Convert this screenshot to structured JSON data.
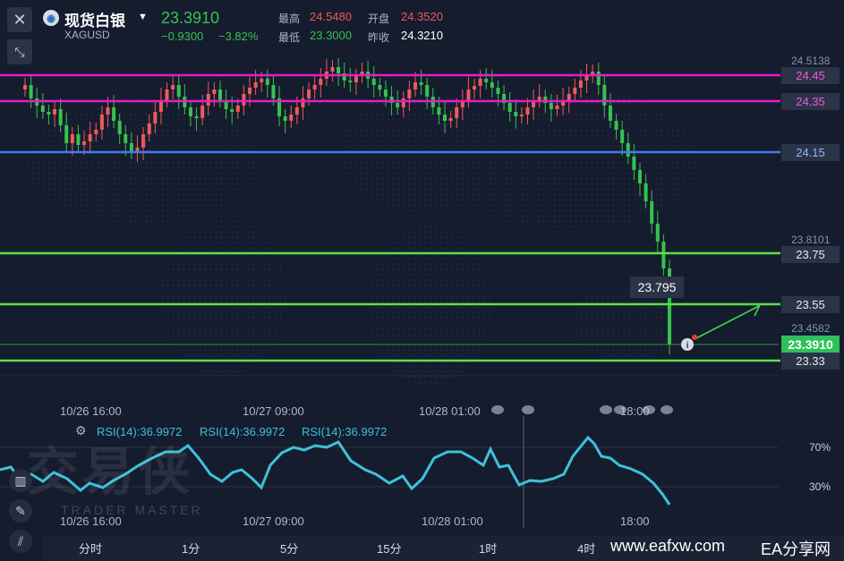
{
  "header": {
    "name": "现货白银",
    "symbol": "XAGUSD",
    "price": "23.3910",
    "change": "−0.9300",
    "change_pct": "−3.82%",
    "high_label": "最高",
    "high_value": "24.5480",
    "open_label": "开盘",
    "open_value": "24.3520",
    "low_label": "最低",
    "low_value": "23.3000",
    "prev_label": "昨收",
    "prev_value": "24.3210"
  },
  "axis": {
    "top": "24.5138",
    "mid": "23.8101",
    "low": "23.4582",
    "rsi_70": "70%",
    "rsi_30": "30%"
  },
  "levels": [
    {
      "label": "24.45",
      "color": "#e51ec8"
    },
    {
      "label": "24.35",
      "color": "#e51ec8"
    },
    {
      "label": "24.15",
      "color": "#3f7df0"
    },
    {
      "label": "23.75",
      "color": "#5be04a"
    },
    {
      "label": "23.55",
      "color": "#5be04a"
    },
    {
      "label": "23.33",
      "color": "#5be04a"
    }
  ],
  "current_price_label": "23.3910",
  "tooltip": "23.795",
  "time_labels": {
    "main": [
      "10/26 16:00",
      "10/27 09:00",
      "10/28 01:00",
      "18:00"
    ],
    "lower": [
      "10/26 16:00",
      "10/27 09:00",
      "10/28 01:00",
      "18:00"
    ]
  },
  "rsi_labels": [
    "RSI(14):36.9972",
    "RSI(14):36.9972",
    "RSI(14):36.9972"
  ],
  "timeframes": [
    "分时",
    "1分",
    "5分",
    "15分",
    "1时",
    "4时"
  ],
  "brand": {
    "site": "www.eafxw.com",
    "name": "EA分享网"
  },
  "watermark": {
    "cn": "交易侠",
    "en": "TRADER MASTER"
  },
  "colors": {
    "up": "#f05a5a",
    "down": "#37c24d",
    "rsi": "#3dc2d9",
    "bg": "#151c2e"
  }
}
